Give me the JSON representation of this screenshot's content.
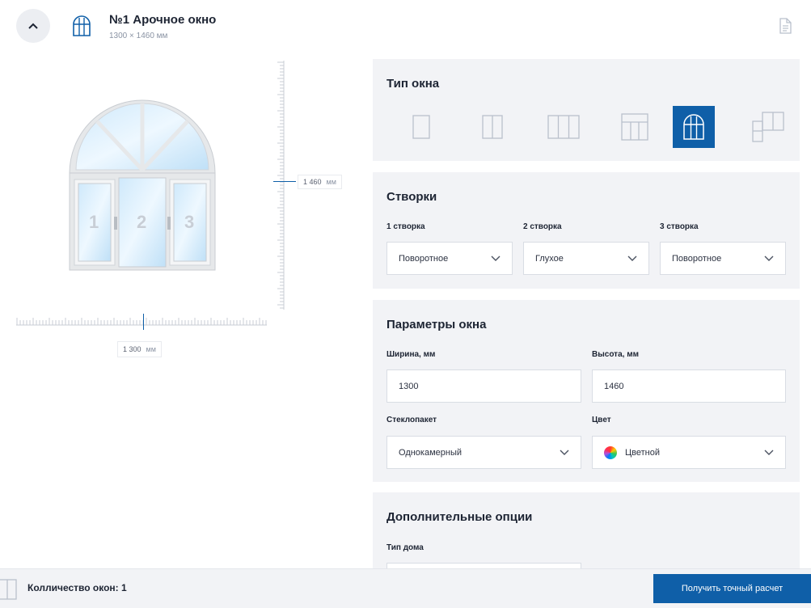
{
  "header": {
    "title": "№1 Арочное окно",
    "size": "1300 × 1460 мм"
  },
  "preview": {
    "sash_numbers": [
      "1",
      "2",
      "3"
    ],
    "height_value": "1 460",
    "width_value": "1 300",
    "unit": "мм"
  },
  "window_type": {
    "title": "Тип окна",
    "options": [
      "single-sash-icon",
      "double-sash-icon",
      "triple-sash-icon",
      "transom-window-icon",
      "arched-window-icon",
      "balcony-block-icon"
    ],
    "selected_index": 4
  },
  "sashes": {
    "title": "Створки",
    "items": [
      {
        "label": "1 створка",
        "value": "Поворотное"
      },
      {
        "label": "2 створка",
        "value": "Глухое"
      },
      {
        "label": "3 створка",
        "value": "Поворотное"
      }
    ]
  },
  "params": {
    "title": "Параметры окна",
    "width_label": "Ширина, мм",
    "width_value": "1300",
    "height_label": "Высота, мм",
    "height_value": "1460",
    "glass_label": "Стеклопакет",
    "glass_value": "Однокамерный",
    "color_label": "Цвет",
    "color_value": "Цветной"
  },
  "extra": {
    "title": "Дополнительные опции",
    "house_type_label": "Тип дома"
  },
  "footer": {
    "count_text": "Колличество окон: 1",
    "cta_label": "Получить точный расчет"
  },
  "colors": {
    "accent": "#0f5fa8",
    "panel_bg": "#f2f3f6"
  }
}
